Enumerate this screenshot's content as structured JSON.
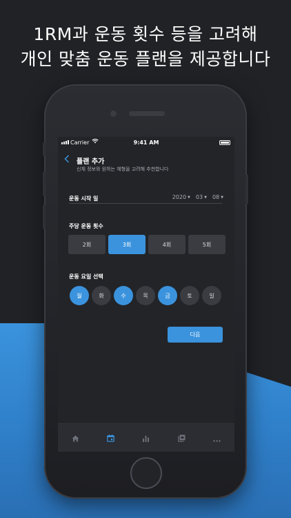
{
  "headline": {
    "line1": "1RM과 운동 횟수 등을 고려해",
    "line2": "개인 맞춤 운동 플랜을 제공합니다"
  },
  "status_bar": {
    "carrier": "Carrier",
    "time": "9:41 AM",
    "icons": [
      "signal-icon",
      "wifi-icon",
      "battery-icon"
    ]
  },
  "header": {
    "back_icon": "chevron-left-icon",
    "title": "플랜 추가",
    "subtitle": "신체 정보와 원하는 체형을 고려해 추천합니다"
  },
  "start_date": {
    "label": "운동 시작 일",
    "year": "2020",
    "month": "03",
    "day": "08"
  },
  "weekly_count": {
    "label": "주당 운동 횟수",
    "options": [
      "2회",
      "3회",
      "4회",
      "5회"
    ],
    "selected": "3회"
  },
  "workout_days": {
    "label": "운동 요일 선택",
    "days": [
      {
        "label": "월",
        "selected": true
      },
      {
        "label": "화",
        "selected": false
      },
      {
        "label": "수",
        "selected": true
      },
      {
        "label": "목",
        "selected": false
      },
      {
        "label": "금",
        "selected": true
      },
      {
        "label": "토",
        "selected": false
      },
      {
        "label": "일",
        "selected": false
      }
    ]
  },
  "next_button": "다음",
  "tabbar": {
    "tabs": [
      {
        "icon": "home-icon",
        "active": false
      },
      {
        "icon": "calendar-icon",
        "active": true
      },
      {
        "icon": "bar-chart-icon",
        "active": false
      },
      {
        "icon": "collection-icon",
        "active": false
      },
      {
        "icon": "more-icon",
        "active": false
      }
    ]
  },
  "colors": {
    "accent": "#3b93dd",
    "background": "#212226",
    "screen": "#232428",
    "inactive_button": "#3a3c42",
    "tab_icon_inactive": "#6d7078"
  }
}
